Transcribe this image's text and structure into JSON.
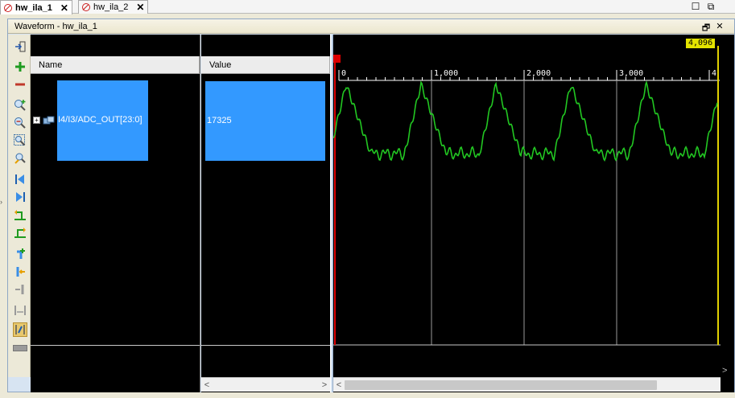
{
  "tabs": [
    {
      "label": "hw_ila_1",
      "close": "✕",
      "active": true
    },
    {
      "label": "hw_ila_2",
      "close": "✕",
      "active": false
    }
  ],
  "window_controls": {
    "restore": "☐",
    "maximize": "⧉"
  },
  "waveform_window": {
    "title": "Waveform - hw_ila_1",
    "controls": {
      "restore": "🗗",
      "close": "✕"
    }
  },
  "toolbar": [
    {
      "name": "zoom-fit-icon",
      "glyph": "⇥"
    },
    {
      "name": "add-icon",
      "glyph": "+"
    },
    {
      "name": "remove-icon",
      "glyph": "−"
    },
    {
      "name": "zoom-in-icon",
      "glyph": "🔍"
    },
    {
      "name": "zoom-out-icon",
      "glyph": "🔍"
    },
    {
      "name": "zoom-full-icon",
      "glyph": "🔍"
    },
    {
      "name": "zoom-cursor-icon",
      "glyph": "🔍"
    },
    {
      "name": "go-first-icon",
      "glyph": "⏮"
    },
    {
      "name": "go-last-icon",
      "glyph": "⏭"
    },
    {
      "name": "previous-transition-icon",
      "glyph": "↰"
    },
    {
      "name": "next-transition-icon",
      "glyph": "↳"
    },
    {
      "name": "add-marker-icon",
      "glyph": "+"
    },
    {
      "name": "previous-marker-icon",
      "glyph": "↰"
    },
    {
      "name": "next-marker-icon",
      "glyph": "↳"
    },
    {
      "name": "swap-cursors-icon",
      "glyph": "⇹"
    },
    {
      "name": "snap-to-transition-icon",
      "glyph": "⇲"
    },
    {
      "name": "floating-ruler-icon",
      "glyph": "▭"
    }
  ],
  "columns": {
    "name": "Name",
    "value": "Value"
  },
  "signal": {
    "name": "I4/I3/ADC_OUT[23:0]",
    "value": "17325",
    "expander": "+"
  },
  "waveform": {
    "ruler_ticks": [
      "0",
      "1,000",
      "2,000",
      "3,000",
      "4"
    ],
    "cursor_value": "4,096",
    "marker_label": "0",
    "trace_color": "#22c722",
    "cursor_color": "#e0d000",
    "marker_color": "#dd0000",
    "samples_per_period": 810
  },
  "scroll_arrows": {
    "left": "<",
    "right": ">"
  }
}
